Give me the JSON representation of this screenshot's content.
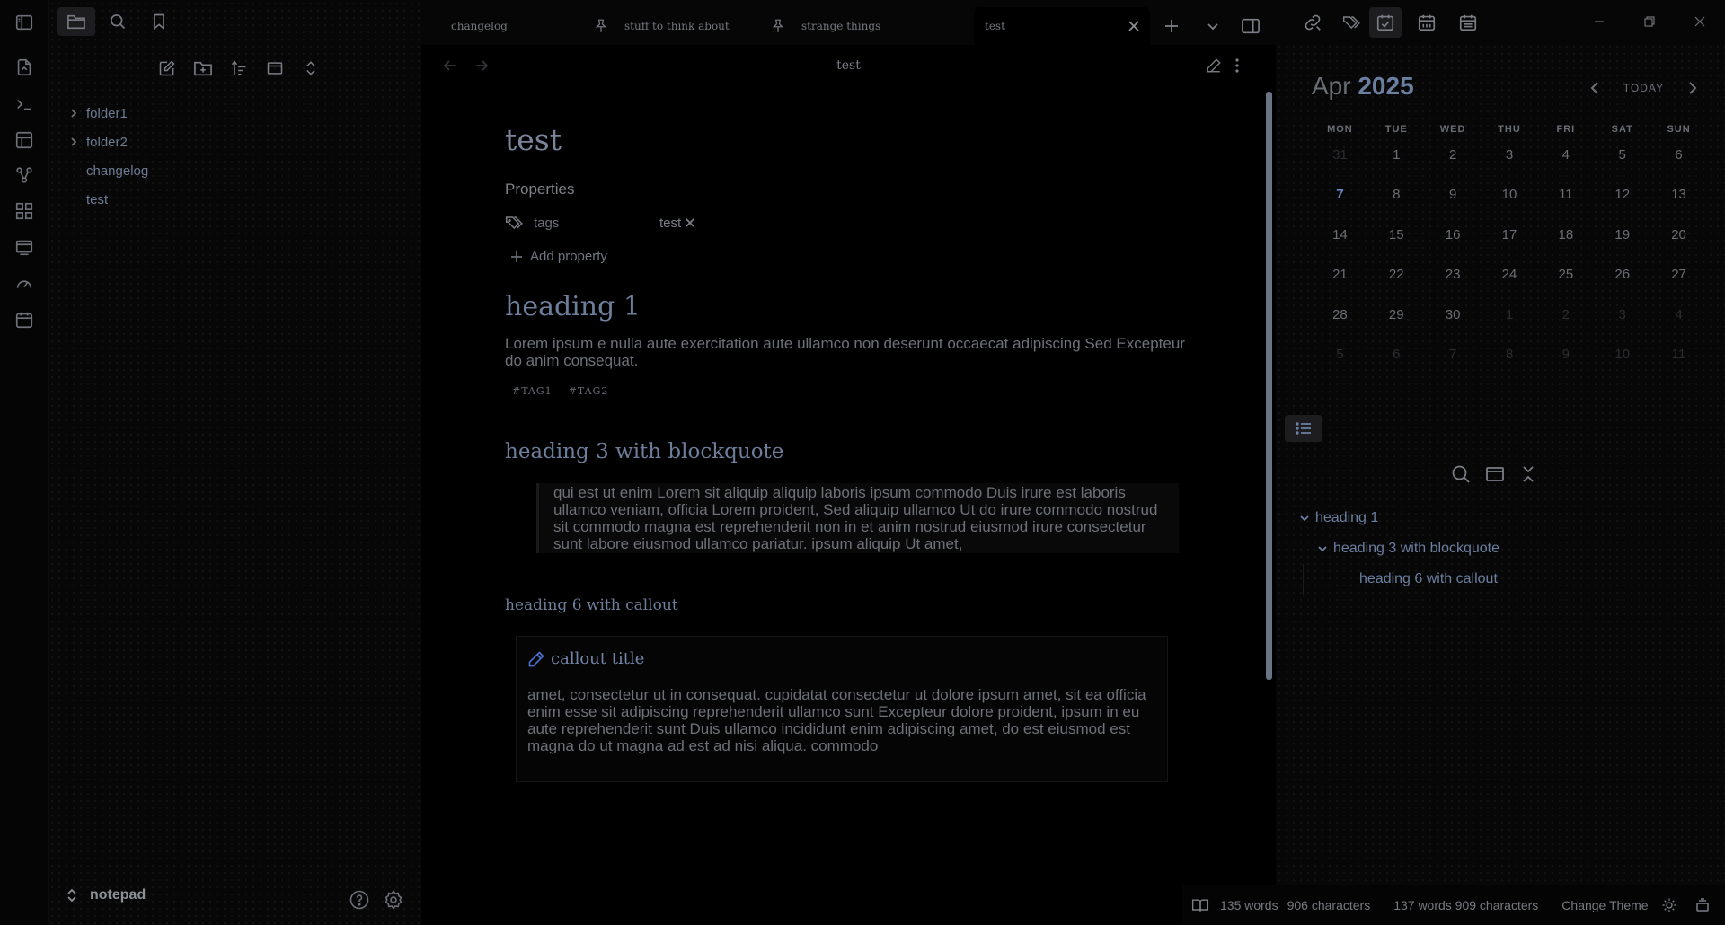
{
  "tabs": [
    {
      "label": "changelog",
      "pinned": false
    },
    {
      "label": "stuff to think about",
      "pinned": true
    },
    {
      "label": "strange things",
      "pinned": true
    },
    {
      "label": "test",
      "pinned": false,
      "active": true
    }
  ],
  "file_tree": [
    {
      "label": "folder1",
      "type": "folder"
    },
    {
      "label": "folder2",
      "type": "folder"
    },
    {
      "label": "changelog",
      "type": "file"
    },
    {
      "label": "test",
      "type": "file"
    }
  ],
  "vault_name": "notepad",
  "editor": {
    "header_title": "test",
    "title": "test",
    "properties_heading": "Properties",
    "property_key": "tags",
    "property_value": "test",
    "add_property": "Add property",
    "heading1": "heading 1",
    "paragraph": "Lorem ipsum e nulla aute exercitation aute ullamco non deserunt occaecat adipiscing Sed Excepteur do anim consequat.",
    "tags": [
      "#TAG1",
      "#TAG2"
    ],
    "heading3": "heading 3 with blockquote",
    "blockquote": "qui est ut enim Lorem sit aliquip aliquip laboris ipsum commodo Duis irure est laboris ullamco veniam, officia Lorem proident, Sed aliquip ullamco Ut do irure commodo nostrud sit commodo magna est reprehenderit non in et anim nostrud eiusmod irure consectetur sunt labore eiusmod ullamco pariatur. ipsum aliquip Ut amet,",
    "heading6": "heading 6 with callout",
    "callout_title": "callout title",
    "callout_body": "amet, consectetur ut in consequat. cupidatat consectetur ut dolore ipsum amet, sit ea officia enim esse sit adipiscing reprehenderit ullamco sunt Excepteur dolore proident, ipsum in eu aute reprehenderit sunt Duis ullamco incididunt enim adipiscing amet, do est eiusmod est magna do ut magna ad est ad nisi aliqua. commodo"
  },
  "calendar": {
    "month": "Apr",
    "year": "2025",
    "today_label": "TODAY",
    "weekdays": [
      "MON",
      "TUE",
      "WED",
      "THU",
      "FRI",
      "SAT",
      "SUN"
    ],
    "weeks": [
      [
        {
          "d": "31",
          "out": true
        },
        {
          "d": "1"
        },
        {
          "d": "2"
        },
        {
          "d": "3"
        },
        {
          "d": "4"
        },
        {
          "d": "5"
        },
        {
          "d": "6"
        }
      ],
      [
        {
          "d": "7",
          "today": true
        },
        {
          "d": "8"
        },
        {
          "d": "9"
        },
        {
          "d": "10"
        },
        {
          "d": "11"
        },
        {
          "d": "12"
        },
        {
          "d": "13"
        }
      ],
      [
        {
          "d": "14"
        },
        {
          "d": "15"
        },
        {
          "d": "16"
        },
        {
          "d": "17"
        },
        {
          "d": "18"
        },
        {
          "d": "19"
        },
        {
          "d": "20"
        }
      ],
      [
        {
          "d": "21"
        },
        {
          "d": "22"
        },
        {
          "d": "23"
        },
        {
          "d": "24"
        },
        {
          "d": "25"
        },
        {
          "d": "26"
        },
        {
          "d": "27"
        }
      ],
      [
        {
          "d": "28"
        },
        {
          "d": "29"
        },
        {
          "d": "30"
        },
        {
          "d": "1",
          "out": true
        },
        {
          "d": "2",
          "out": true
        },
        {
          "d": "3",
          "out": true
        },
        {
          "d": "4",
          "out": true
        }
      ],
      [
        {
          "d": "5",
          "out": true
        },
        {
          "d": "6",
          "out": true
        },
        {
          "d": "7",
          "out": true
        },
        {
          "d": "8",
          "out": true
        },
        {
          "d": "9",
          "out": true
        },
        {
          "d": "10",
          "out": true
        },
        {
          "d": "11",
          "out": true
        }
      ]
    ]
  },
  "outline": [
    {
      "label": "heading 1",
      "level": 1,
      "collapsible": true
    },
    {
      "label": "heading 3 with blockquote",
      "level": 2,
      "collapsible": true
    },
    {
      "label": "heading 6 with callout",
      "level": 3,
      "collapsible": false
    }
  ],
  "status": {
    "words_1": "135 words",
    "chars_1": "906 characters",
    "count_2": "137 words 909 characters",
    "theme": "Change Theme"
  },
  "colors": {
    "accent": "#6b7fa0",
    "today": "#6b88c4",
    "callout_icon": "#4a6fd0"
  }
}
